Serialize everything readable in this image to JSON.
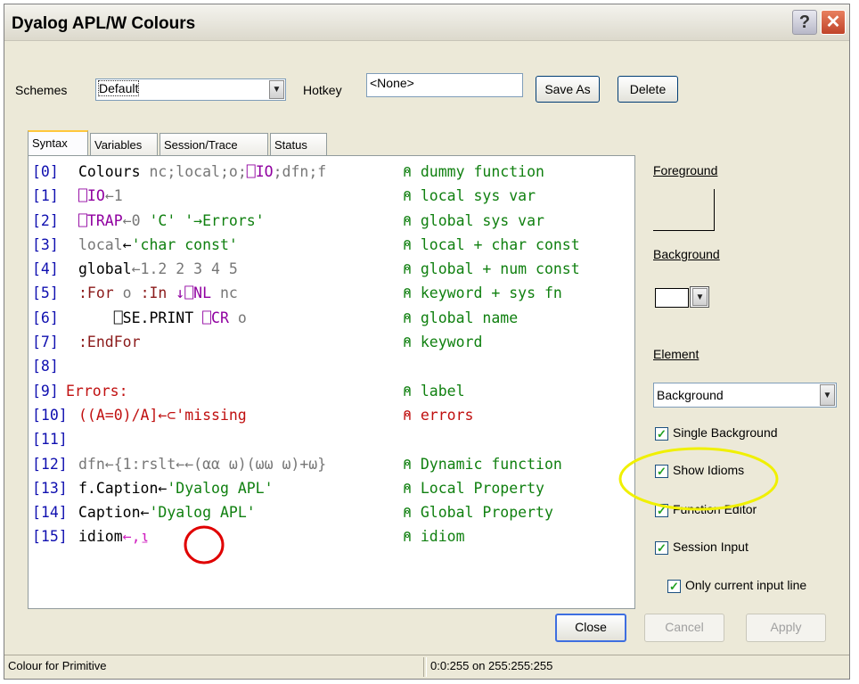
{
  "window": {
    "title": "Dyalog APL/W Colours"
  },
  "toolbar": {
    "schemes_label": "Schemes",
    "schemes_value": "Default",
    "hotkey_label": "Hotkey",
    "hotkey_value": "<None>",
    "save_as": "Save As",
    "delete": "Delete"
  },
  "tabs": [
    "Syntax",
    "Variables",
    "Session/Trace",
    "Status"
  ],
  "code_lines": [
    {
      "ln": "[0]",
      "code": [
        [
          "Colours ",
          "blk"
        ],
        [
          "nc;local;o;",
          "gry"
        ],
        [
          "⎕IO",
          "pur"
        ],
        [
          ";dfn;f",
          "gry"
        ]
      ],
      "comment": "⍝ dummy function"
    },
    {
      "ln": "[1]",
      "code": [
        [
          "⎕IO",
          "pur"
        ],
        [
          "←1",
          "gry"
        ]
      ],
      "comment": "⍝ local sys var"
    },
    {
      "ln": "[2]",
      "code": [
        [
          "⎕TRAP",
          "pur"
        ],
        [
          "←0 ",
          "gry"
        ],
        [
          "'C' '→Errors'",
          "grn"
        ]
      ],
      "comment": "⍝ global sys var"
    },
    {
      "ln": "[3]",
      "code": [
        [
          "local",
          "gry"
        ],
        [
          "←",
          "blk"
        ],
        [
          "'char const'",
          "grn"
        ]
      ],
      "comment": "⍝ local + char const"
    },
    {
      "ln": "[4]",
      "code": [
        [
          "global",
          "blk"
        ],
        [
          "←1.2 2 3 4 5",
          "gry"
        ]
      ],
      "comment": "⍝ global + num const"
    },
    {
      "ln": "[5]",
      "code": [
        [
          ":For",
          "dred"
        ],
        [
          " o ",
          "gry"
        ],
        [
          ":In",
          "dred"
        ],
        [
          " ↓⎕NL",
          "pur"
        ],
        [
          " nc",
          "gry"
        ]
      ],
      "comment": "⍝ keyword + sys fn"
    },
    {
      "ln": "[6]",
      "code": [
        [
          "    ⎕SE.PRINT ",
          "blk"
        ],
        [
          "⎕CR",
          "pur"
        ],
        [
          " o",
          "gry"
        ]
      ],
      "comment": "⍝ global name"
    },
    {
      "ln": "[7]",
      "code": [
        [
          ":EndFor",
          "dred"
        ]
      ],
      "comment": "⍝ keyword"
    },
    {
      "ln": "[8]",
      "code": [],
      "comment": ""
    },
    {
      "ln": "[9]",
      "code": [
        [
          "Errors:",
          "red"
        ]
      ],
      "comment": "⍝ label",
      "outdent": true
    },
    {
      "ln": "[10]",
      "code": [
        [
          "((A=0)/A]←⊂'missing",
          "red"
        ]
      ],
      "comment": "⍝ errors",
      "comment_color": "red"
    },
    {
      "ln": "[11]",
      "code": [],
      "comment": ""
    },
    {
      "ln": "[12]",
      "code": [
        [
          "dfn←{1:rslt←←(αα ω)(ωω ω)+ω}",
          "gry"
        ]
      ],
      "comment": "⍝ Dynamic function"
    },
    {
      "ln": "[13]",
      "code": [
        [
          "f.Caption←",
          "blk"
        ],
        [
          "'Dyalog APL'",
          "grn"
        ]
      ],
      "comment": "⍝ Local Property"
    },
    {
      "ln": "[14]",
      "code": [
        [
          "Caption←",
          "blk"
        ],
        [
          "'Dyalog APL'",
          "grn"
        ]
      ],
      "comment": "⍝ Global Property"
    },
    {
      "ln": "[15]",
      "code": [
        [
          "idiom",
          "blk"
        ],
        [
          "←,⍸",
          "mag"
        ]
      ],
      "comment": "⍝ idiom"
    }
  ],
  "right_panel": {
    "foreground_label": "Foreground",
    "background_label": "Background",
    "element_label": "Element",
    "element_value": "Background",
    "checkboxes": [
      {
        "label": "Single Background",
        "checked": true
      },
      {
        "label": "Show Idioms",
        "checked": true
      },
      {
        "label": "Function Editor",
        "checked": true
      },
      {
        "label": "Session Input",
        "checked": true
      },
      {
        "label": "Only current input line",
        "checked": true
      }
    ]
  },
  "buttons": {
    "close": "Close",
    "cancel": "Cancel",
    "apply": "Apply"
  },
  "status": {
    "left": "Colour for Primitive",
    "right": "0:0:255 on 255:255:255"
  },
  "colors": {
    "highlight_circle_yellow": "#f0f000",
    "highlight_circle_red": "#e00000"
  }
}
